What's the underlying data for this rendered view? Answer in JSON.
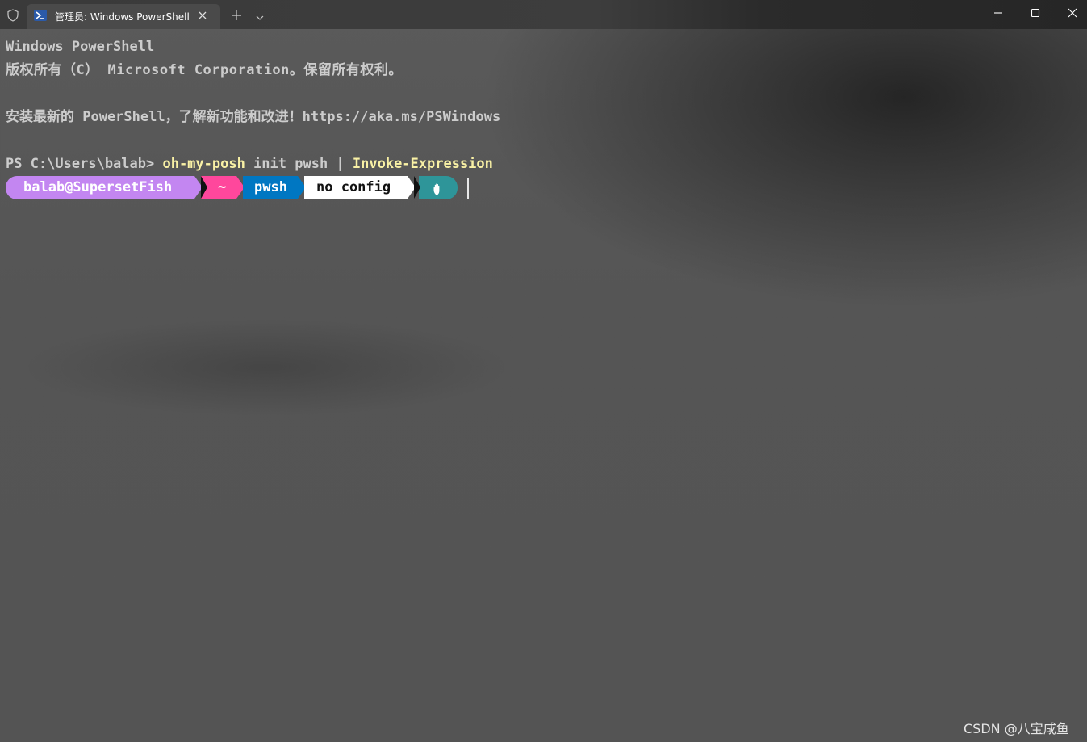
{
  "titlebar": {
    "tab_title": "管理员: Windows PowerShell",
    "icons": {
      "shield": "shield-icon",
      "tab": "powershell-icon",
      "close_tab": "close-icon",
      "new_tab": "plus-icon",
      "dropdown": "chevron-down-icon",
      "minimize": "minimize-icon",
      "maximize": "maximize-icon",
      "close_window": "close-icon"
    }
  },
  "terminal": {
    "line1": "Windows PowerShell",
    "line2": "版权所有（C） Microsoft Corporation。保留所有权利。",
    "line4": "安装最新的 PowerShell，了解新功能和改进！https://aka.ms/PSWindows",
    "prompt_prefix": "PS C:\\Users\\balab> ",
    "command_name": "oh-my-posh",
    "command_args": " init pwsh | ",
    "command_pipe_target": "Invoke-Expression"
  },
  "prompt": {
    "user_host": "balab@SupersetFish",
    "path": "~",
    "shell": "pwsh",
    "config": "no config",
    "exit_icon": "hand-icon"
  },
  "colors": {
    "user_bg": "#c386f1",
    "path_bg": "#ff479c",
    "shell_bg": "#0077c2",
    "config_bg": "#ffffff",
    "exit_bg": "#2e9599",
    "command_highlight": "#f9f1a5",
    "terminal_text": "#cccccc"
  },
  "watermark": "CSDN @八宝咸鱼"
}
